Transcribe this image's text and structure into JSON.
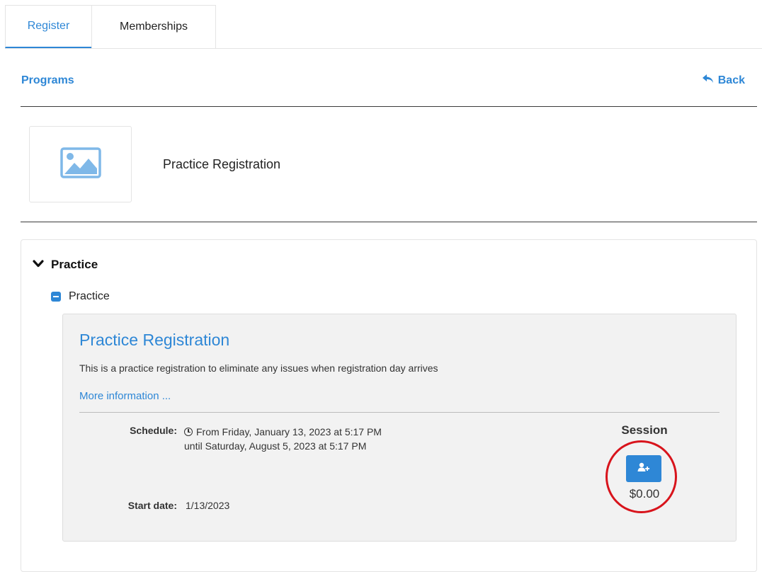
{
  "tabs": [
    {
      "label": "Register",
      "active": true
    },
    {
      "label": "Memberships",
      "active": false
    }
  ],
  "breadcrumb": {
    "programs_label": "Programs",
    "back_label": "Back"
  },
  "program": {
    "title": "Practice Registration",
    "image_icon": "image-placeholder-icon"
  },
  "group": {
    "label": "Practice",
    "icon": "chevron-down-icon"
  },
  "subgroup": {
    "label": "Practice",
    "icon": "minus-square-icon"
  },
  "registration": {
    "title": "Practice Registration",
    "description": "This is a practice registration to eliminate any issues when registration day arrives",
    "more_info_label": "More information ...",
    "schedule_label": "Schedule:",
    "schedule_value": "From Friday, January 13, 2023 at 5:17 PM until Saturday, August 5, 2023 at 5:17 PM",
    "start_date_label": "Start date:",
    "start_date_value": "1/13/2023",
    "session_heading": "Session",
    "add_button_icon": "add-user-icon",
    "price": "$0.00"
  },
  "colors": {
    "accent": "#2e87d6",
    "highlight": "#d8141c",
    "card_bg": "#f2f2f2"
  }
}
